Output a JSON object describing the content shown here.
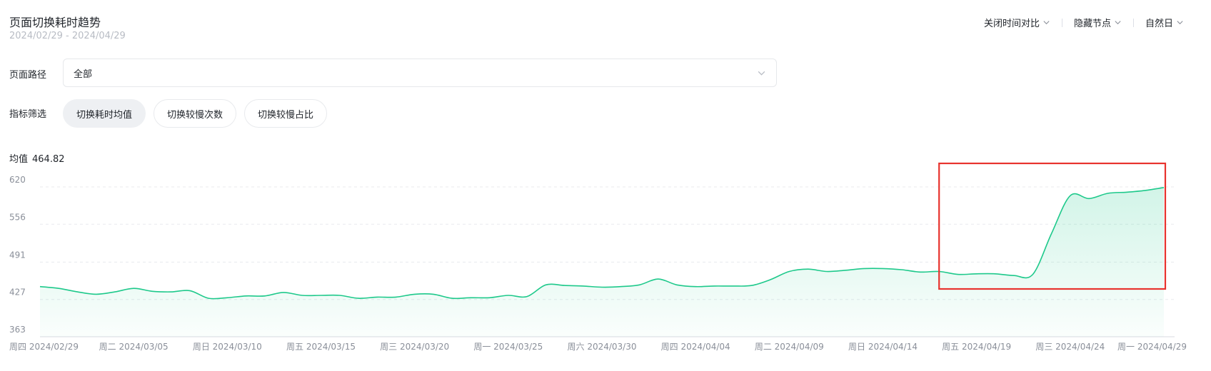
{
  "header": {
    "title": "页面切换耗时趋势",
    "date_range": "2024/02/29 - 2024/04/29"
  },
  "toolbar": {
    "compare_label": "关闭时间对比",
    "nodes_label": "隐藏节点",
    "granularity_label": "自然日"
  },
  "filters": {
    "path_label": "页面路径",
    "path_value": "全部",
    "metric_label": "指标筛选",
    "metrics": [
      "切换耗时均值",
      "切换较慢次数",
      "切换较慢占比"
    ],
    "active_metric": 0
  },
  "summary": {
    "avg_label": "均值",
    "avg_value": "464.82"
  },
  "chart_data": {
    "type": "area",
    "ylim": [
      363,
      620
    ],
    "yticks": [
      "620",
      "556",
      "491",
      "427",
      "363"
    ],
    "xtick_labels": [
      "周四 2024/02/29",
      "周二 2024/03/05",
      "周日 2024/03/10",
      "周五 2024/03/15",
      "周三 2024/03/20",
      "周一 2024/03/25",
      "周六 2024/03/30",
      "周四 2024/04/04",
      "周二 2024/04/09",
      "周日 2024/04/14",
      "周五 2024/04/19",
      "周三 2024/04/24",
      "周一 2024/04/29"
    ],
    "x": [
      "2024/02/29",
      "2024/03/01",
      "2024/03/02",
      "2024/03/03",
      "2024/03/04",
      "2024/03/05",
      "2024/03/06",
      "2024/03/07",
      "2024/03/08",
      "2024/03/09",
      "2024/03/10",
      "2024/03/11",
      "2024/03/12",
      "2024/03/13",
      "2024/03/14",
      "2024/03/15",
      "2024/03/16",
      "2024/03/17",
      "2024/03/18",
      "2024/03/19",
      "2024/03/20",
      "2024/03/21",
      "2024/03/22",
      "2024/03/23",
      "2024/03/24",
      "2024/03/25",
      "2024/03/26",
      "2024/03/27",
      "2024/03/28",
      "2024/03/29",
      "2024/03/30",
      "2024/03/31",
      "2024/04/01",
      "2024/04/02",
      "2024/04/03",
      "2024/04/04",
      "2024/04/05",
      "2024/04/06",
      "2024/04/07",
      "2024/04/08",
      "2024/04/09",
      "2024/04/10",
      "2024/04/11",
      "2024/04/12",
      "2024/04/13",
      "2024/04/14",
      "2024/04/15",
      "2024/04/16",
      "2024/04/17",
      "2024/04/18",
      "2024/04/19",
      "2024/04/20",
      "2024/04/21",
      "2024/04/22",
      "2024/04/23",
      "2024/04/24",
      "2024/04/25",
      "2024/04/26",
      "2024/04/27",
      "2024/04/28",
      "2024/04/29"
    ],
    "series": [
      {
        "color": "#1ec98b",
        "values": [
          449,
          446,
          440,
          436,
          440,
          446,
          441,
          440,
          442,
          429,
          430,
          433,
          433,
          439,
          434,
          434,
          434,
          429,
          431,
          431,
          436,
          436,
          429,
          430,
          430,
          434,
          432,
          452,
          451,
          450,
          448,
          449,
          452,
          462,
          452,
          449,
          450,
          450,
          451,
          461,
          475,
          479,
          475,
          477,
          480,
          480,
          478,
          474,
          475,
          470,
          471,
          471,
          468,
          470,
          540,
          605,
          600,
          609,
          611,
          614,
          619
        ]
      }
    ],
    "grid": true,
    "highlight": {
      "from": "2024/04/17",
      "to": "2024/04/29",
      "color": "#e8332e"
    }
  }
}
